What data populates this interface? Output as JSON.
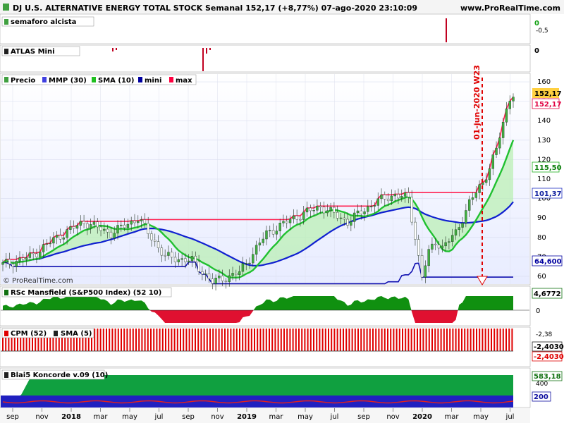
{
  "header": {
    "title": "DJ U.S. ALTERNATIVE ENERGY TOTAL STOCK Semanal 152,17 (+8,77%) 07-ago-2020 23:10:09",
    "site": "www.ProRealTime.com"
  },
  "panels": {
    "semaforo": {
      "label": "semaforo alcista",
      "axis_top": "0",
      "axis_bottom": "-0,5"
    },
    "atlas": {
      "label": "ATLAS Mini",
      "axis": "0"
    },
    "price": {
      "legend": [
        "Precio",
        "MMP (30)",
        "SMA (10)",
        "mini",
        "max"
      ],
      "legend_colors": [
        "#40a040",
        "#4040e0",
        "#20c020",
        "#0000a0",
        "#ff0040"
      ],
      "annotation": "01-jun-2020 W23",
      "watermark": "© ProRealTime.com",
      "badges": {
        "close_label": "152,17",
        "max_label": "152,17",
        "sma_label": "115,50",
        "mmp_label": "101,37",
        "mini_label": "64,600"
      }
    },
    "rsc": {
      "label": "RSc Mansfield (S&P500 Index) (52 10)",
      "axis_top": "4,6772",
      "axis_zero": "0"
    },
    "cpm": {
      "label": "CPM (52)",
      "label2": "SMA (5)",
      "axis_top": "-2,38",
      "badge1": "-2,4030",
      "badge2": "-2,4030"
    },
    "koncorde": {
      "label": "Blai5 Koncorde v.09 (10)",
      "axis_top": "583,18",
      "axis_mid": "400",
      "badge": "200"
    }
  },
  "x_axis": {
    "labels": [
      "sep",
      "nov",
      "2018",
      "mar",
      "may",
      "jul",
      "sep",
      "nov",
      "2019",
      "mar",
      "may",
      "jul",
      "sep",
      "nov",
      "2020",
      "mar",
      "may",
      "jul"
    ]
  },
  "chart_data": {
    "type": "line",
    "title": "DJ U.S. ALTERNATIVE ENERGY TOTAL STOCK Semanal 152,17 (+8,77%) 07-ago-2020 23:10:09",
    "y_ticks": [
      60,
      70,
      80,
      90,
      100,
      110,
      120,
      130,
      140,
      150,
      160
    ],
    "ylim": [
      56,
      164
    ],
    "grid": true,
    "legend_placement": "top-left",
    "anchors_week_index": [
      0,
      8,
      16,
      24,
      32,
      40,
      48,
      56,
      62,
      70,
      78,
      86,
      94,
      102,
      110,
      116,
      120,
      124,
      126,
      128,
      130,
      134,
      138,
      142,
      146,
      150
    ],
    "anchors_close": [
      66,
      70,
      80,
      88,
      82,
      90,
      70,
      68,
      57,
      62,
      82,
      90,
      96,
      88,
      98,
      102,
      100,
      60,
      72,
      78,
      75,
      82,
      98,
      108,
      125,
      152
    ],
    "series": [
      {
        "name": "Precio",
        "values": "weekly candles"
      },
      {
        "name": "MMP (30)"
      },
      {
        "name": "SMA (10)"
      },
      {
        "name": "mini"
      },
      {
        "name": "max"
      }
    ],
    "last_values": {
      "close": 152.17,
      "sma": 115.5,
      "mmp": 101.37,
      "mini": 64.6,
      "max": 152.17
    }
  }
}
